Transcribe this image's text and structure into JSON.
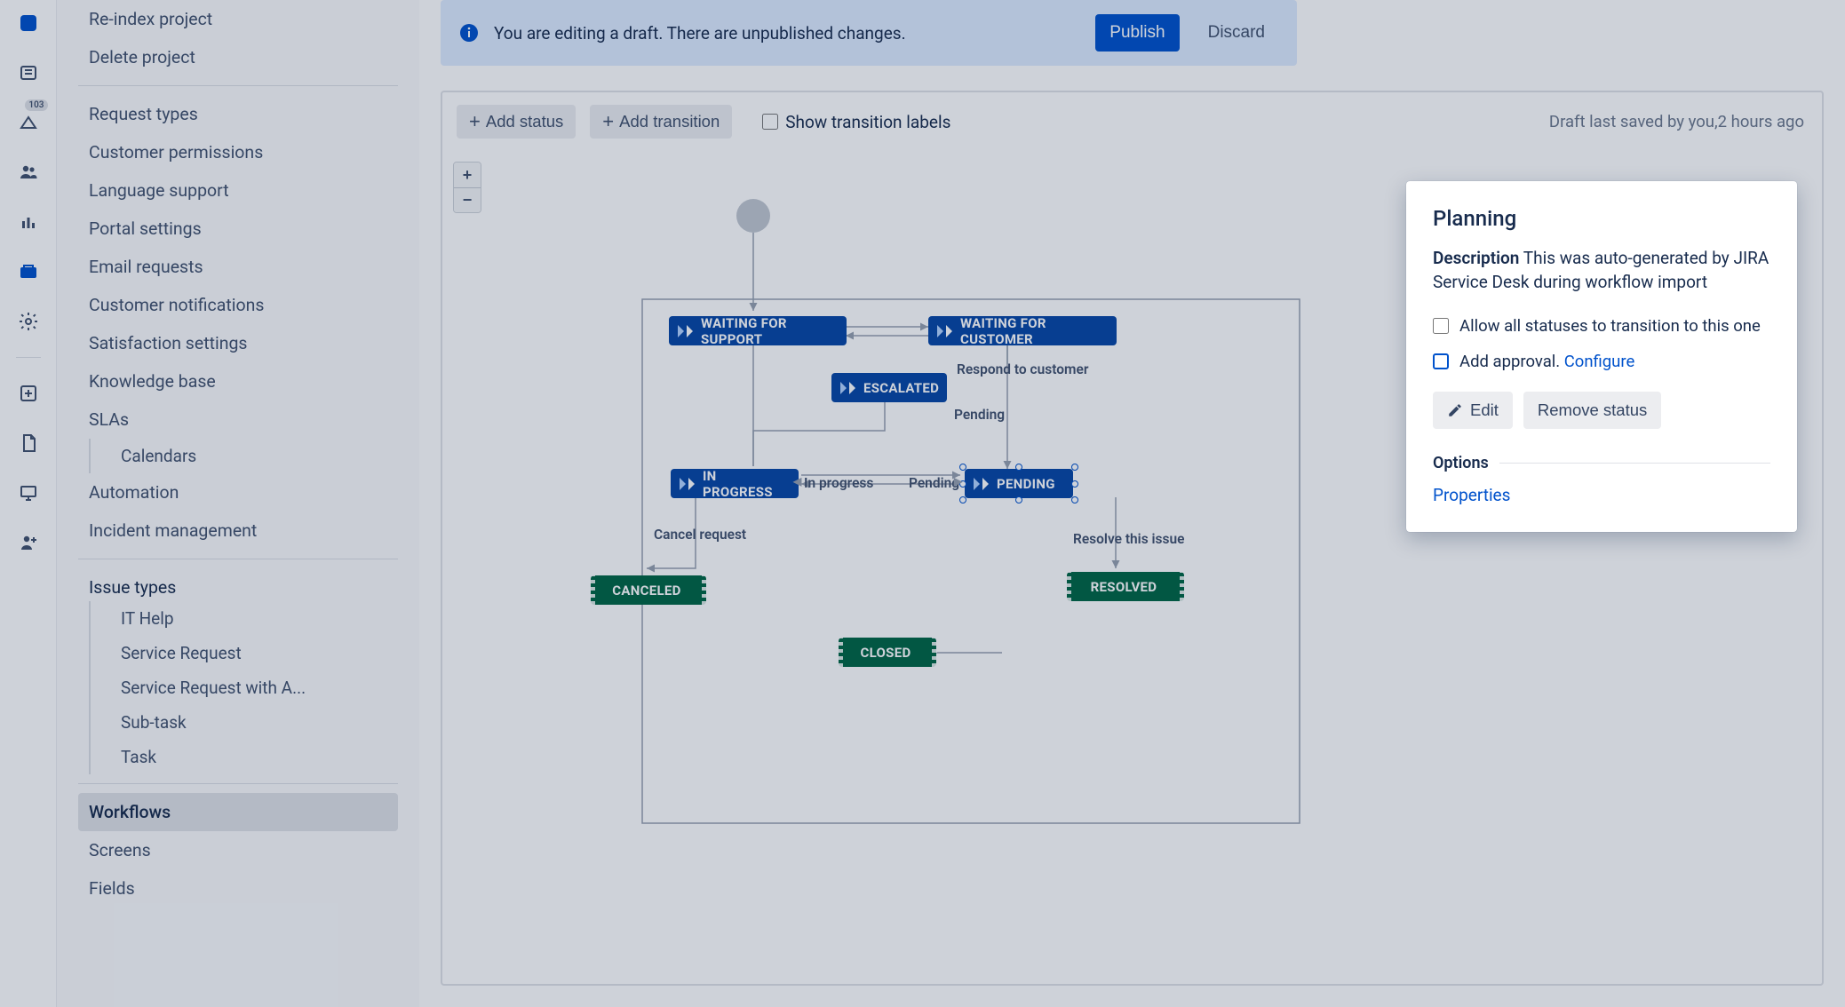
{
  "rail": {
    "badge": "103"
  },
  "sidebar": {
    "group1": [
      "Re-index project",
      "Delete project"
    ],
    "group2": [
      "Request types",
      "Customer permissions",
      "Language support",
      "Portal settings",
      "Email requests",
      "Customer notifications",
      "Satisfaction settings",
      "Knowledge base"
    ],
    "slas_label": "SLAs",
    "slas_sub": "Calendars",
    "automation": "Automation",
    "incident": "Incident management",
    "issue_types_label": "Issue types",
    "issue_types": [
      "IT Help",
      "Service Request",
      "Service Request with A...",
      "Sub-task",
      "Task"
    ],
    "group3": [
      "Workflows",
      "Screens",
      "Fields"
    ],
    "group3_selected": "Workflows"
  },
  "banner": {
    "text": "You are editing a draft. There are unpublished changes.",
    "publish": "Publish",
    "discard": "Discard"
  },
  "toolbar": {
    "add_status": "Add status",
    "add_transition": "Add transition",
    "show_labels": "Show transition labels",
    "saved_prefix": "Draft last saved by you,",
    "saved_time": "2 hours ago"
  },
  "zoom": {
    "in": "+",
    "out": "−"
  },
  "statuses": {
    "waiting_support": "WAITING FOR SUPPORT",
    "waiting_customer": "WAITING FOR CUSTOMER",
    "escalated": "ESCALATED",
    "in_progress": "IN PROGRESS",
    "pending": "PENDING",
    "canceled": "CANCELED",
    "resolved": "RESOLVED",
    "closed": "CLOSED"
  },
  "transitions": {
    "respond": "Respond to customer",
    "pending1": "Pending",
    "in_progress": "In progress",
    "pending2": "Pending",
    "cancel": "Cancel request",
    "resolve": "Resolve this issue"
  },
  "panel": {
    "title": "Planning",
    "desc_label": "Description",
    "desc_text": "This was auto-generated by JIRA Service Desk during workflow import",
    "opt_allow": "Allow all statuses to transition to this one",
    "opt_approval": "Add approval.",
    "configure": "Configure",
    "edit": "Edit",
    "remove": "Remove status",
    "options": "Options",
    "properties": "Properties"
  }
}
